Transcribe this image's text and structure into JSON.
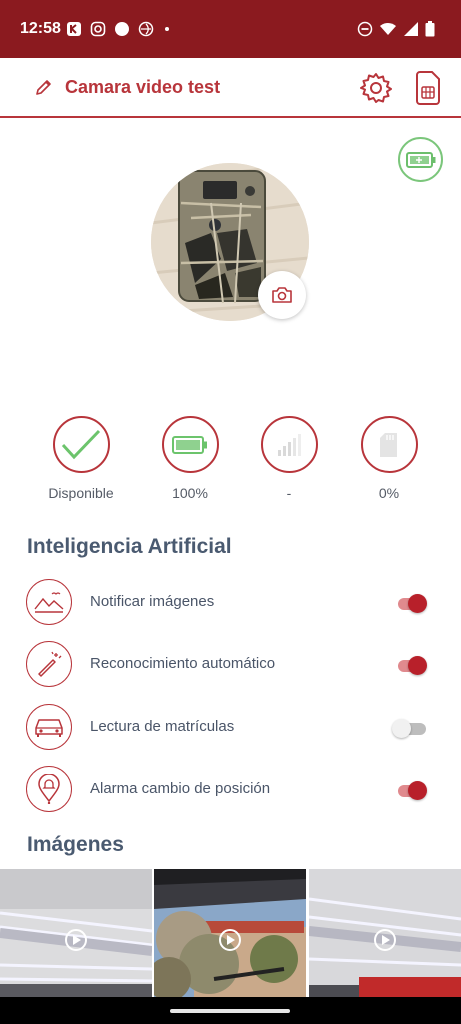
{
  "statusbar": {
    "time": "12:58"
  },
  "appbar": {
    "title": "Camara video test"
  },
  "status": [
    {
      "label": "Disponible",
      "icon": "check-icon"
    },
    {
      "label": "100%",
      "icon": "battery-icon"
    },
    {
      "label": "-",
      "icon": "signal-icon"
    },
    {
      "label": "0%",
      "icon": "sd-card-icon"
    }
  ],
  "ai": {
    "title": "Inteligencia Artificial",
    "items": [
      {
        "label": "Notificar imágenes",
        "icon": "landscape-icon",
        "enabled": true
      },
      {
        "label": "Reconocimiento automático",
        "icon": "magic-wand-icon",
        "enabled": true
      },
      {
        "label": "Lectura de matrículas",
        "icon": "car-icon",
        "enabled": false
      },
      {
        "label": "Alarma cambio de posición",
        "icon": "location-bell-icon",
        "enabled": true
      }
    ]
  },
  "images": {
    "title": "Imágenes",
    "count_visible": 3
  },
  "colors": {
    "brand": "#b8353b",
    "statusbar": "#8b1a1f",
    "success": "#7bc67b",
    "heading": "#4a5a70"
  }
}
